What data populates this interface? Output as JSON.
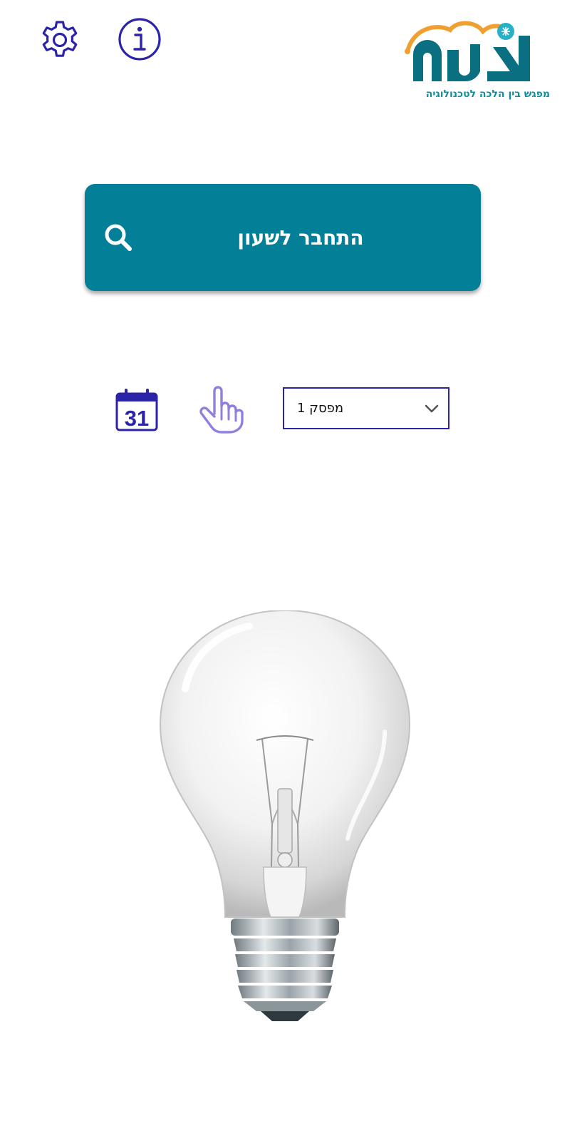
{
  "header": {
    "settings_icon": "gear-icon",
    "info_icon": "info-icon",
    "logo": {
      "tagline": "מפגש בין הלכה לטכנולוגיה",
      "colors": {
        "teal": "#0a6f80",
        "orange": "#f0a030",
        "accent": "#27b0c8"
      }
    }
  },
  "main": {
    "connect_button": {
      "label": "התחבר לשעון",
      "icon": "search-icon",
      "color": "#047f98"
    },
    "calendar_icon": {
      "name": "calendar-icon",
      "day": "31"
    },
    "hand_icon": "pointer-hand-icon",
    "switch_select": {
      "value": "מפסק 1",
      "icon": "chevron-down-icon"
    },
    "bulb_image": "light-bulb"
  },
  "colors": {
    "icon_blue": "#2b23a8",
    "hand_purple": "#8f80e0"
  }
}
